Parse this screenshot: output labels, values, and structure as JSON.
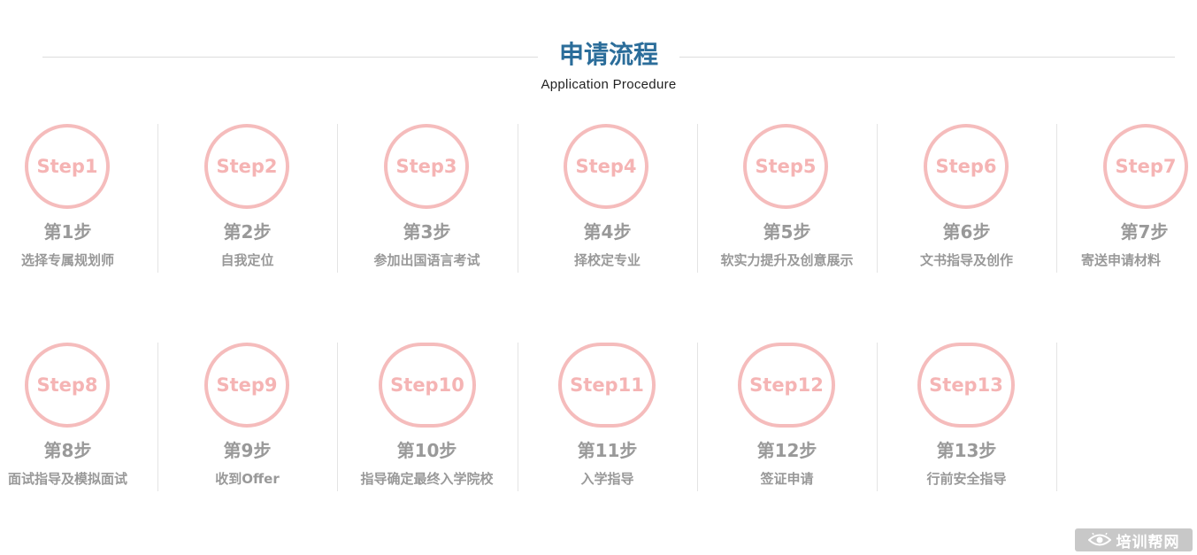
{
  "header": {
    "title": "申请流程",
    "subtitle": "Application Procedure"
  },
  "steps_row1": [
    {
      "badge": "Step1",
      "num": "第1步",
      "desc": "选择专属规划师"
    },
    {
      "badge": "Step2",
      "num": "第2步",
      "desc": "自我定位"
    },
    {
      "badge": "Step3",
      "num": "第3步",
      "desc": "参加出国语言考试"
    },
    {
      "badge": "Step4",
      "num": "第4步",
      "desc": "择校定专业"
    },
    {
      "badge": "Step5",
      "num": "第5步",
      "desc": "软实力提升及创意展示"
    },
    {
      "badge": "Step6",
      "num": "第6步",
      "desc": "文书指导及创作"
    },
    {
      "badge": "Step7",
      "num": "第7步",
      "desc": "寄送申请材料"
    }
  ],
  "steps_row2": [
    {
      "badge": "Step8",
      "num": "第8步",
      "desc": "面试指导及模拟面试"
    },
    {
      "badge": "Step9",
      "num": "第9步",
      "desc": "收到Offer"
    },
    {
      "badge": "Step10",
      "num": "第10步",
      "desc": "指导确定最终入学院校"
    },
    {
      "badge": "Step11",
      "num": "第11步",
      "desc": "入学指导"
    },
    {
      "badge": "Step12",
      "num": "第12步",
      "desc": "签证申请"
    },
    {
      "badge": "Step13",
      "num": "第13步",
      "desc": "行前安全指导"
    }
  ],
  "watermark": {
    "text": "培训帮网",
    "icon": "eye-icon"
  },
  "colors": {
    "title": "#2b6d9a",
    "circle_border": "#f5bcbc",
    "circle_text": "#f5b4b4",
    "step_text": "#999999",
    "divider": "#e4e4e4"
  }
}
